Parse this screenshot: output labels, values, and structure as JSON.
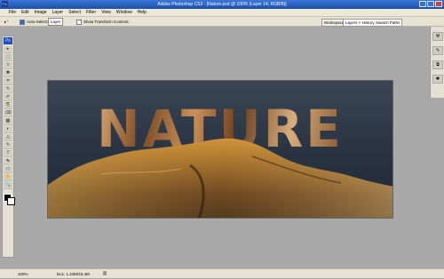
{
  "window": {
    "title": "Adobe Photoshop CS3 - [Nature.psd @ 100% (Layer 14, RGB/8)]",
    "app_logo": "Ps"
  },
  "menu": [
    "File",
    "Edit",
    "Image",
    "Layer",
    "Select",
    "Filter",
    "View",
    "Window",
    "Help"
  ],
  "options": {
    "auto_select_label": "Auto-Select:",
    "auto_select_value": "Layer",
    "show_transform_label": "Show Transform Controls",
    "workspace_label": "Workspace ▾",
    "palette_well": "Layers × History Swatch Paths"
  },
  "tools": {
    "badge": "Ps",
    "glyphs": [
      "▸",
      "⬚",
      "ℓ",
      "✱",
      "⌗",
      "✎",
      "✐",
      "⎘",
      "⌫",
      "▦",
      "◐",
      "◬",
      "✎",
      "T",
      "⬉",
      "▭",
      "✋",
      "🔍"
    ]
  },
  "right_dock": [
    "⚒",
    "✎",
    "⧉",
    "✱"
  ],
  "canvas": {
    "headline": "NATURE",
    "background_top": "#3a4656",
    "background_bottom": "#1f2733"
  },
  "status": {
    "zoom": "100%",
    "doc": "Doc: 1.44M/43.4M"
  }
}
